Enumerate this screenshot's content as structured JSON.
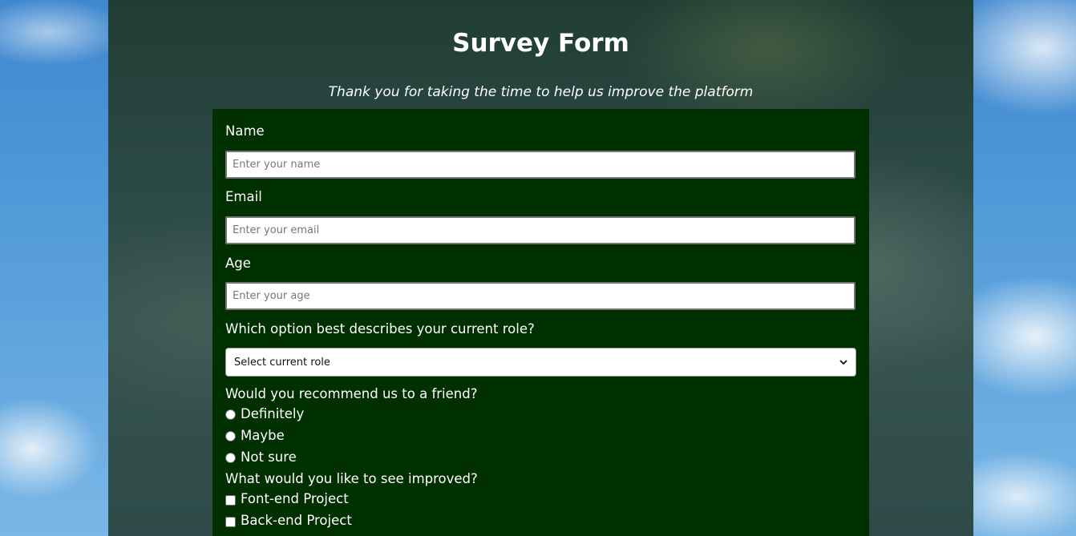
{
  "page": {
    "title": "Survey Form",
    "subtitle": "Thank you for taking the time to help us improve the platform"
  },
  "form": {
    "name": {
      "label": "Name",
      "placeholder": "Enter your name",
      "value": ""
    },
    "email": {
      "label": "Email",
      "placeholder": "Enter your email",
      "value": ""
    },
    "age": {
      "label": "Age",
      "placeholder": "Enter your age",
      "value": ""
    },
    "role": {
      "label": "Which option best describes your current role?",
      "selected": "Select current role"
    },
    "recommend": {
      "label": "Would you recommend us to a friend?",
      "options": [
        "Definitely",
        "Maybe",
        "Not sure"
      ]
    },
    "improve": {
      "label": "What would you like to see improved?",
      "options": [
        "Font-end Project",
        "Back-end Project"
      ]
    }
  },
  "colors": {
    "form_background": "#003000",
    "text": "#ffffff"
  }
}
